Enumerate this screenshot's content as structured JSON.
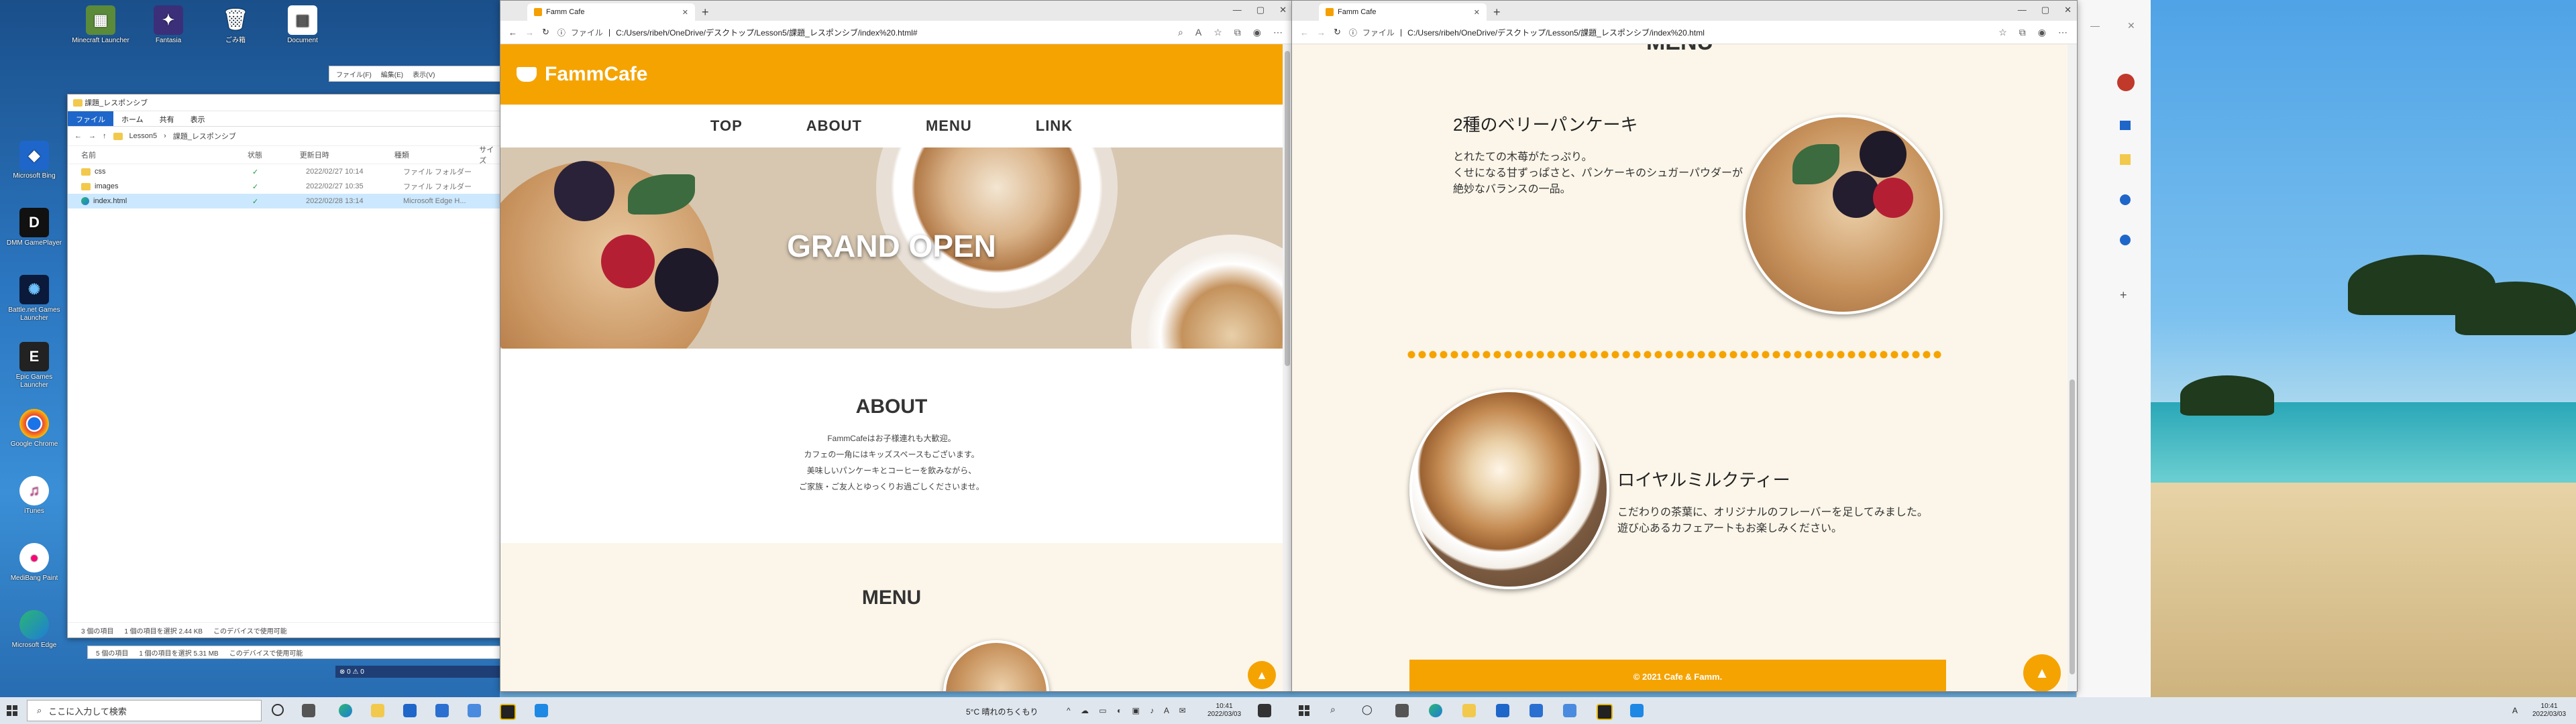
{
  "desktop": {
    "icons": [
      {
        "label": "Minecraft Launcher",
        "icon": "minecraft-icon"
      },
      {
        "label": "Fantasia",
        "icon": "game-icon"
      },
      {
        "label": "ごみ箱",
        "icon": "recycle-bin-icon"
      },
      {
        "label": "Document",
        "icon": "document-icon"
      },
      {
        "label": "Microsoft Bing",
        "icon": "app-icon"
      },
      {
        "label": "DMM GamePlayer",
        "icon": "dmm-icon"
      },
      {
        "label": "Battle.net Games Launcher",
        "icon": "battlenet-icon"
      },
      {
        "label": "Epic Games Launcher",
        "icon": "epic-icon"
      },
      {
        "label": "Google Chrome",
        "icon": "chrome-icon"
      },
      {
        "label": "iTunes",
        "icon": "itunes-icon"
      },
      {
        "label": "MediBang Paint",
        "icon": "medibang-icon"
      },
      {
        "label": "Microsoft Edge",
        "icon": "edge-icon"
      }
    ]
  },
  "explorer": {
    "title": "課題_レスポンシブ",
    "ribbon": [
      "ファイル",
      "ホーム",
      "共有",
      "表示"
    ],
    "breadcrumb": [
      "Lesson5",
      "課題_レスポンシブ"
    ],
    "columns": [
      "名前",
      "状態",
      "更新日時",
      "種類",
      "サイズ"
    ],
    "rows": [
      {
        "name": "css",
        "status": "✓",
        "date": "2022/02/27 10:14",
        "type": "ファイル フォルダー"
      },
      {
        "name": "images",
        "status": "✓",
        "date": "2022/02/27 10:35",
        "type": "ファイル フォルダー"
      },
      {
        "name": "index.html",
        "status": "✓",
        "date": "2022/02/28 13:14",
        "type": "Microsoft Edge H..."
      }
    ],
    "status_count": "3 個の項目",
    "status_selected": "1 個の項目を選択  2.44 KB",
    "status_avail": "このデバイスで使用可能",
    "status2_count": "5 個の項目",
    "status2_selected": "1 個の項目を選択  5.31 MB",
    "status2_avail": "このデバイスで使用可能",
    "bg_menu": [
      "ファイル(F)",
      "編集(E)",
      "表示(V)"
    ]
  },
  "browser_left": {
    "tab_title": "Famm Cafe",
    "url_label": "ファイル",
    "url": "C:/Users/ribeh/OneDrive/デスクトップ/Lesson5/課題_レスポンシブ/index%20.html#",
    "site": {
      "logo": "FammCafe",
      "nav": [
        "TOP",
        "ABOUT",
        "MENU",
        "LINK"
      ],
      "hero_title": "GRAND OPEN",
      "about_title": "ABOUT",
      "about_lines": [
        "FammCafeはお子様連れも大歓迎。",
        "カフェの一角にはキッズスペースもございます。",
        "美味しいパンケーキとコーヒーを飲みながら、",
        "ご家族・ご友人とゆっくりお過ごしくださいませ。"
      ],
      "menu_title": "MENU",
      "totop": "▲"
    }
  },
  "browser_right": {
    "tab_title": "Famm Cafe",
    "url_label": "ファイル",
    "url": "C:/Users/ribeh/OneDrive/デスクトップ/Lesson5/課題_レスポンシブ/index%20.html",
    "menu_title": "MENU",
    "items": [
      {
        "name": "2種のベリーパンケーキ",
        "lines": [
          "とれたての木苺がたっぷり。",
          "くせになる甘ずっぱさと、パンケーキのシュガーパウダーが",
          "絶妙なバランスの一品。"
        ]
      },
      {
        "name": "ロイヤルミルクティー",
        "lines": [
          "こだわりの茶葉に、オリジナルのフレーバーを足してみました。",
          "遊び心あるカフェアートもお楽しみください。"
        ]
      }
    ],
    "footer": "© 2021 Cafe & Famm.",
    "totop": "▲"
  },
  "taskbar": {
    "search_placeholder": "ここに入力して検索",
    "weather": "5°C  晴れのちくもり",
    "time_left": "10:41",
    "date_left": "2022/03/03",
    "time_right": "10:41",
    "date_right": "2022/03/03",
    "tray_label": "A"
  },
  "colors": {
    "brand": "#f5a300",
    "cream": "#fcf6ea"
  }
}
